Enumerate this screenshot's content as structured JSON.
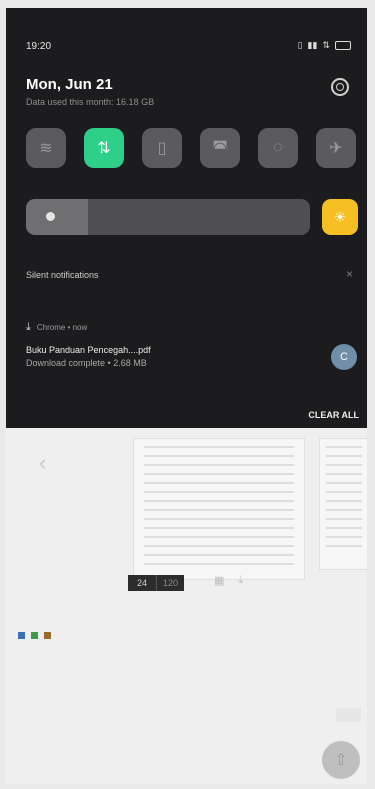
{
  "status_bar": {
    "time": "19:20"
  },
  "header": {
    "date": "Mon, Jun 21",
    "data_used": "Data used this month: 16.18 GB"
  },
  "quick_tiles": [
    {
      "id": "wifi",
      "icon": "wifi-icon",
      "on": false,
      "glyph": "≋"
    },
    {
      "id": "mobile-data",
      "icon": "mobile-data-icon",
      "on": true,
      "glyph": "⇅"
    },
    {
      "id": "flashlight",
      "icon": "flashlight-icon",
      "on": false,
      "glyph": "▯"
    },
    {
      "id": "screen-cast",
      "icon": "screen-cast-icon",
      "on": false,
      "glyph": "◚"
    },
    {
      "id": "rotate",
      "icon": "auto-rotate-icon",
      "on": false,
      "glyph": "◌"
    },
    {
      "id": "airplane",
      "icon": "airplane-icon",
      "on": false,
      "glyph": "✈"
    }
  ],
  "brightness": {
    "level": 0.22
  },
  "silent_section": {
    "label": "Silent notifications"
  },
  "notification": {
    "app": "Chrome • now",
    "title": "Buku Panduan Pencegah....pdf",
    "subtitle": "Download complete • 2.68 MB",
    "avatar_letter": "C"
  },
  "clear_all": "CLEAR ALL",
  "background_app": {
    "pager_current": "24",
    "pager_total": "120"
  },
  "colors": {
    "shade_bg": "#1c1c1e",
    "tile_on": "#2ecf88",
    "brightness_accent": "#f6c025"
  }
}
